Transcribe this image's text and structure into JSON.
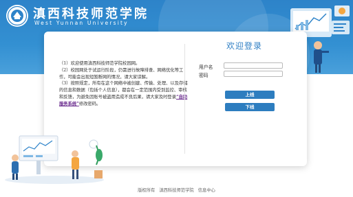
{
  "header": {
    "school_name": "滇西科技师范学院",
    "school_name_en": "West Yunnan University"
  },
  "notice": {
    "p1": "（1）欢迎使用滇西科技师范学院校园网。",
    "p2": "（2）校园网处于试运行阶段，仍需进行故障排查、网络优化等工作，可能会出现短暂断网的情况，请大家谅解。",
    "p3_before": "（3）按照规定，所有在这个网络中被创建、传输、处理、以及存储的信息和数据（包括个人信息），都会在一定范围内受到监控、审核和反馈，为避免因账号被盗用造成不良后果，请大家及时登录",
    "p3_link": "“自助服务系统”",
    "p3_after": "修改密码。"
  },
  "login": {
    "title": "欢迎登录",
    "username_label": "用户名",
    "password_label": "密码",
    "username_value": "",
    "password_value": "",
    "login_button": "上线",
    "logout_button": "下线"
  },
  "footer": {
    "copyright": "版权所有",
    "org": "滇西科技师范学院",
    "dept": "信息中心"
  },
  "colors": {
    "banner": "#3390d2",
    "accent": "#2d7dbf",
    "title": "#2f7fc4",
    "link": "#6a2c8e"
  }
}
